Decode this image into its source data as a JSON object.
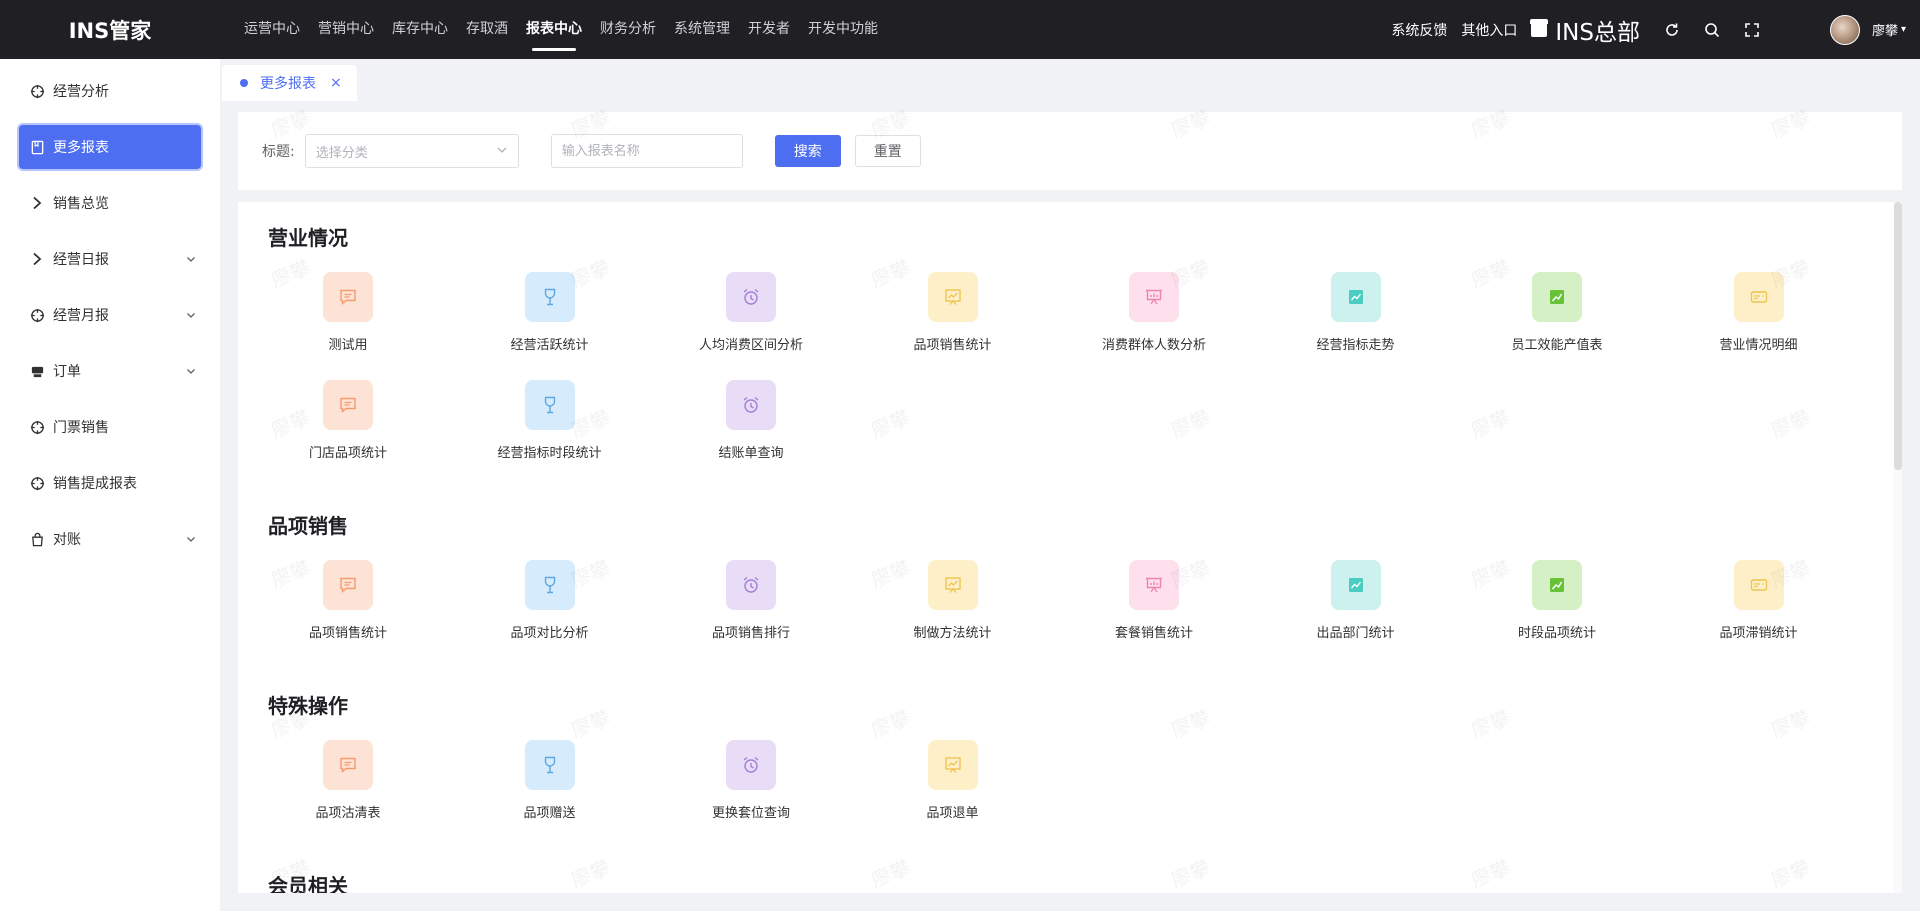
{
  "brand": "INS管家",
  "top_nav": [
    "运营中心",
    "营销中心",
    "库存中心",
    "存取酒",
    "报表中心",
    "财务分析",
    "系统管理",
    "开发者",
    "开发中功能"
  ],
  "top_nav_active": 4,
  "top_right": {
    "feedback": "系统反馈",
    "other_entry": "其他入口",
    "shop_name": "INS总部",
    "user_name": "廖攀"
  },
  "sidebar": [
    {
      "label": "经营分析",
      "icon": "crosshair-icon",
      "caret": false,
      "active": false
    },
    {
      "label": "更多报表",
      "icon": "book-icon",
      "caret": false,
      "active": true
    },
    {
      "label": "销售总览",
      "icon": "chevron-right-icon",
      "caret": false,
      "active": false
    },
    {
      "label": "经营日报",
      "icon": "chevron-right-icon",
      "caret": true,
      "active": false
    },
    {
      "label": "经营月报",
      "icon": "crosshair-icon",
      "caret": true,
      "active": false
    },
    {
      "label": "订单",
      "icon": "printer-icon",
      "caret": true,
      "active": false
    },
    {
      "label": "门票销售",
      "icon": "crosshair-icon",
      "caret": false,
      "active": false
    },
    {
      "label": "销售提成报表",
      "icon": "crosshair-icon",
      "caret": false,
      "active": false
    },
    {
      "label": "对账",
      "icon": "bag-icon",
      "caret": true,
      "active": false
    }
  ],
  "tab": {
    "label": "更多报表",
    "close": "×"
  },
  "filter": {
    "label": "标题:",
    "category_placeholder": "选择分类",
    "name_placeholder": "输入报表名称",
    "search_label": "搜索",
    "reset_label": "重置"
  },
  "watermark": "廖攀",
  "sections": [
    {
      "title": "营业情况",
      "items": [
        "测试用",
        "经营活跃统计",
        "人均消费区间分析",
        "品项销售统计",
        "消费群体人数分析",
        "经营指标走势",
        "员工效能产值表",
        "营业情况明细",
        "门店品项统计",
        "经营指标时段统计",
        "结账单查询"
      ]
    },
    {
      "title": "品项销售",
      "items": [
        "品项销售统计",
        "品项对比分析",
        "品项销售排行",
        "制做方法统计",
        "套餐销售统计",
        "出品部门统计",
        "时段品项统计",
        "品项滞销统计"
      ]
    },
    {
      "title": "特殊操作",
      "items": [
        "品项沽清表",
        "品项赠送",
        "更换套位查询",
        "品项退单"
      ]
    },
    {
      "title": "会员相关",
      "items": []
    }
  ],
  "icon_styles": [
    {
      "name": "message-icon",
      "bg": "#fde3d6",
      "fg": "#f59a6f"
    },
    {
      "name": "wine-glass-icon",
      "bg": "#d6ebfb",
      "fg": "#5aa9e6"
    },
    {
      "name": "alarm-clock-icon",
      "bg": "#e9dcf7",
      "fg": "#a27fd6"
    },
    {
      "name": "chart-board-icon",
      "bg": "#fdf0c9",
      "fg": "#efc450"
    },
    {
      "name": "presentation-icon",
      "bg": "#fde0ec",
      "fg": "#ee85ab"
    },
    {
      "name": "trend-chart-icon",
      "bg": "#cdf1ee",
      "fg": "#4ccbc0"
    },
    {
      "name": "growth-chart-icon",
      "bg": "#d6f0c6",
      "fg": "#67c23a"
    },
    {
      "name": "card-icon",
      "bg": "#fdf0c9",
      "fg": "#efc450"
    }
  ]
}
